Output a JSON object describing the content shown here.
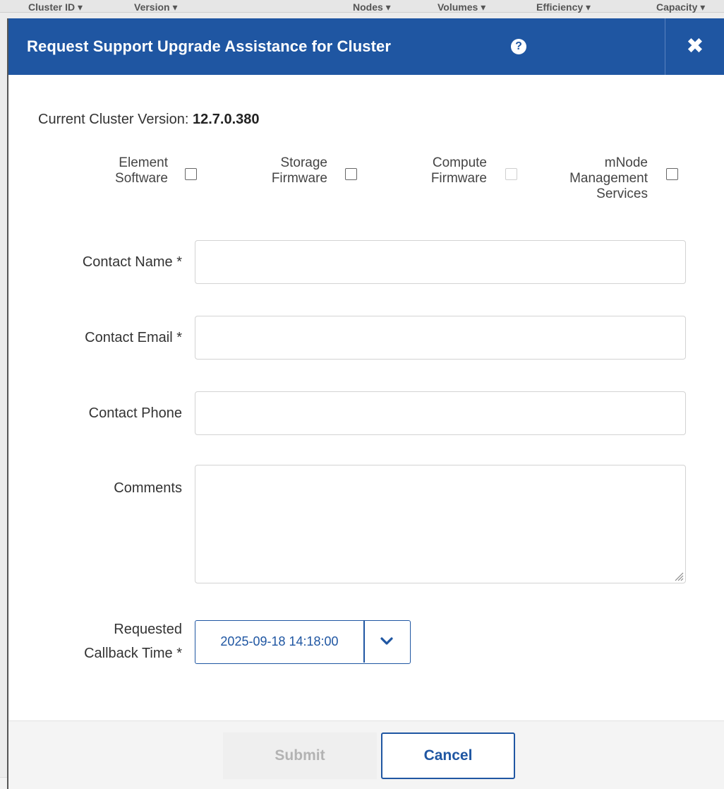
{
  "background": {
    "columns": [
      "Cluster ID ▾",
      "Version ▾",
      "Nodes ▾",
      "Volumes ▾",
      "Efficiency ▾",
      "Capacity ▾"
    ],
    "footer_cells": [
      "...",
      "...",
      "...",
      "...",
      "...",
      "..."
    ]
  },
  "modal": {
    "title": "Request Support Upgrade Assistance for Cluster",
    "help_icon": "?",
    "close_icon": "✖",
    "version_label": "Current Cluster Version: ",
    "version_value": "12.7.0.380",
    "upgrade_options": [
      {
        "label_lines": [
          "Element",
          "Software"
        ],
        "checked": false,
        "disabled": false
      },
      {
        "label_lines": [
          "Storage",
          "Firmware"
        ],
        "checked": false,
        "disabled": false
      },
      {
        "label_lines": [
          "Compute",
          "Firmware"
        ],
        "checked": false,
        "disabled": true
      },
      {
        "label_lines": [
          "mNode",
          "Management",
          "Services"
        ],
        "checked": false,
        "disabled": false
      }
    ],
    "fields": {
      "contact_name_label": "Contact Name *",
      "contact_name_value": "",
      "contact_email_label": "Contact Email *",
      "contact_email_value": "",
      "contact_phone_label": "Contact Phone",
      "contact_phone_value": "",
      "comments_label": "Comments",
      "comments_value": "",
      "callback_label_1": "Requested",
      "callback_label_2": "Callback Time *",
      "callback_value": "2025-09-18 14:18:00"
    },
    "buttons": {
      "submit": "Submit",
      "cancel": "Cancel"
    },
    "colors": {
      "header": "#1f56a2",
      "accent": "#1f56a2"
    }
  }
}
